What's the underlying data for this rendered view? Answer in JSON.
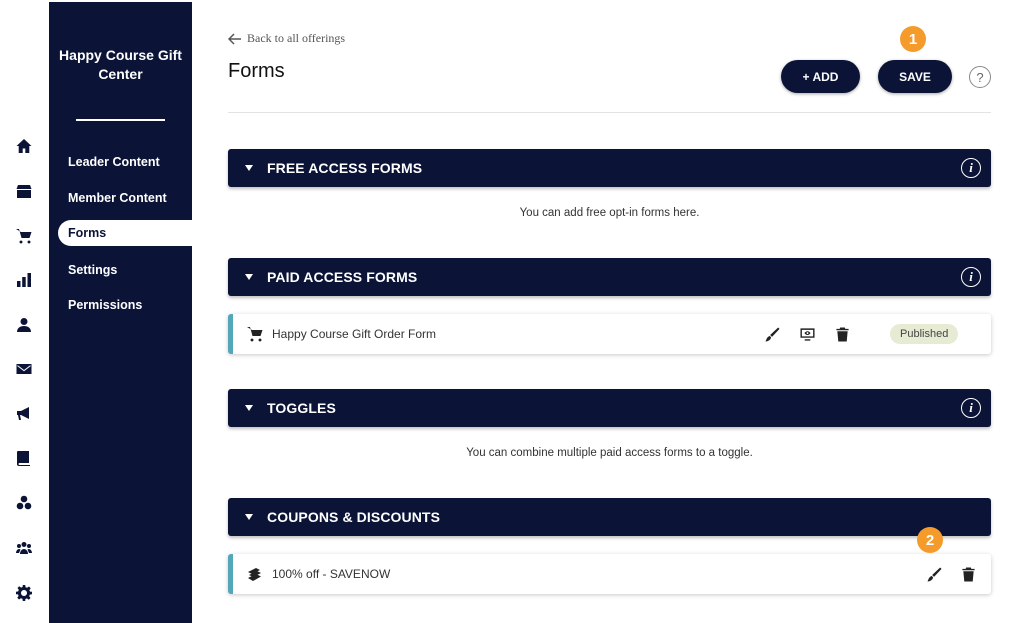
{
  "rail": {
    "icons": [
      "home-icon",
      "store-icon",
      "cart-icon",
      "chart-icon",
      "person-icon",
      "mail-icon",
      "megaphone-icon",
      "book-icon",
      "community-icon",
      "group-icon",
      "gear-icon"
    ]
  },
  "sidebar": {
    "title": "Happy Course Gift Center",
    "items": [
      {
        "label": "Leader Content"
      },
      {
        "label": "Member Content"
      },
      {
        "label": "Forms"
      },
      {
        "label": "Settings"
      },
      {
        "label": "Permissions"
      }
    ]
  },
  "header": {
    "back_label": "Back to all offerings",
    "title": "Forms",
    "add_label": "+ ADD",
    "save_label": "SAVE",
    "help_label": "?"
  },
  "markers": {
    "first": "1",
    "second": "2"
  },
  "colors": {
    "navy": "#0b1437",
    "accent_teal": "#53a7b8",
    "marker_orange": "#f59b2b",
    "published_badge": "#e6ecd4"
  },
  "sections": {
    "free": {
      "title": "FREE ACCESS FORMS",
      "hint": "You can add free opt-in forms here."
    },
    "paid": {
      "title": "PAID ACCESS FORMS",
      "item": {
        "label": "Happy Course Gift Order Form",
        "status": "Published"
      }
    },
    "toggles": {
      "title": "TOGGLES",
      "hint": "You can combine multiple paid access forms to a toggle."
    },
    "coupons": {
      "title": "COUPONS & DISCOUNTS",
      "item": {
        "label": "100% off - SAVENOW"
      }
    }
  }
}
